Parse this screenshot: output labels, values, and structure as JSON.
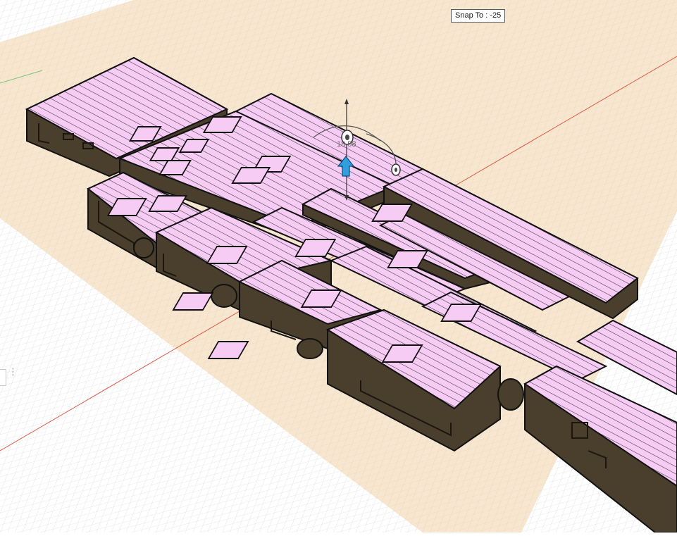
{
  "snap_tooltip": {
    "label": "Snap To : -25"
  },
  "manipulator": {
    "angle_label": "18.58"
  },
  "side_panel": {
    "grip_glyph": "⋮"
  },
  "colors": {
    "grid_line": "#cfd3d7",
    "grid_major": "#b7bcc2",
    "sketch_plane": "#f7e7d0",
    "sketch_grid": "#ecd8bb",
    "body_side": "#4a3f2c",
    "body_top": "#f6ccf4",
    "hatch": "#3b3340",
    "pocket_wall": "#5b5040",
    "arrow": "#2f9fe0",
    "axis_red": "#e05a4a",
    "axis_green": "#76c47a"
  },
  "icons": [
    "move-arrow-icon",
    "rotation-handle-icon",
    "grip-dots-icon"
  ]
}
